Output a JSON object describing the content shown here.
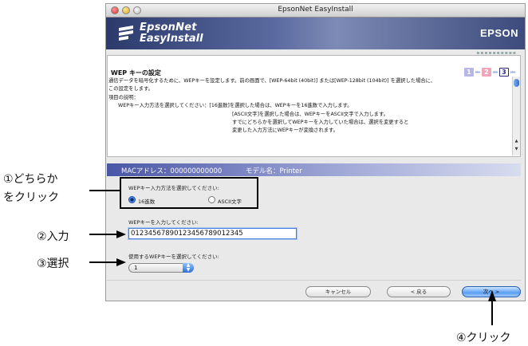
{
  "window": {
    "title": "EpsonNet EasyInstall"
  },
  "banner": {
    "brand_line1": "EpsonNet",
    "brand_line2": "EasyInstall",
    "vendor": "EPSON"
  },
  "section": {
    "title": "WEP キーの設定",
    "steps": [
      "1",
      "2",
      "3"
    ],
    "active_step": "3",
    "description": [
      "通信データを暗号化するために、WEPキーを設定します。前の画面で、[WEP-64bit (40bit)] または[WEP-128bit (104bit)] を選択した場合に、",
      "この設定をします。",
      "",
      "項目の説明：",
      "WEPキー入力方法を選択してください：[16進数]を選択した場合は、WEPキーを16進数で入力します。",
      "[ASCII文字]を選択した場合は、WEPキーをASCII文字で入力します。",
      "すでにどちらかを選択してWEPキーを入力していた場合は、選択を変更すると",
      "変更した入力方法にWEPキーが変換されます。"
    ]
  },
  "device": {
    "mac": "MACアドレス：000000000000",
    "model": "モデル名：Printer"
  },
  "form": {
    "method_label": "WEPキー入力方法を選択してください:",
    "method_options": [
      "16進数",
      "ASCII文字"
    ],
    "method_selected": "16進数",
    "key_label": "WEPキーを入力してください:",
    "key_value": "01234567890123456789012345",
    "index_label": "使用するWEPキーを選択してください:",
    "index_value": "1"
  },
  "buttons": {
    "cancel": "キャンセル",
    "back": "< 戻る",
    "next": "次へ >"
  },
  "annotations": {
    "a1_line1": "①どちらか",
    "a1_line2": "をクリック",
    "a2": "②入力",
    "a3": "③選択",
    "a4": "④クリック"
  }
}
